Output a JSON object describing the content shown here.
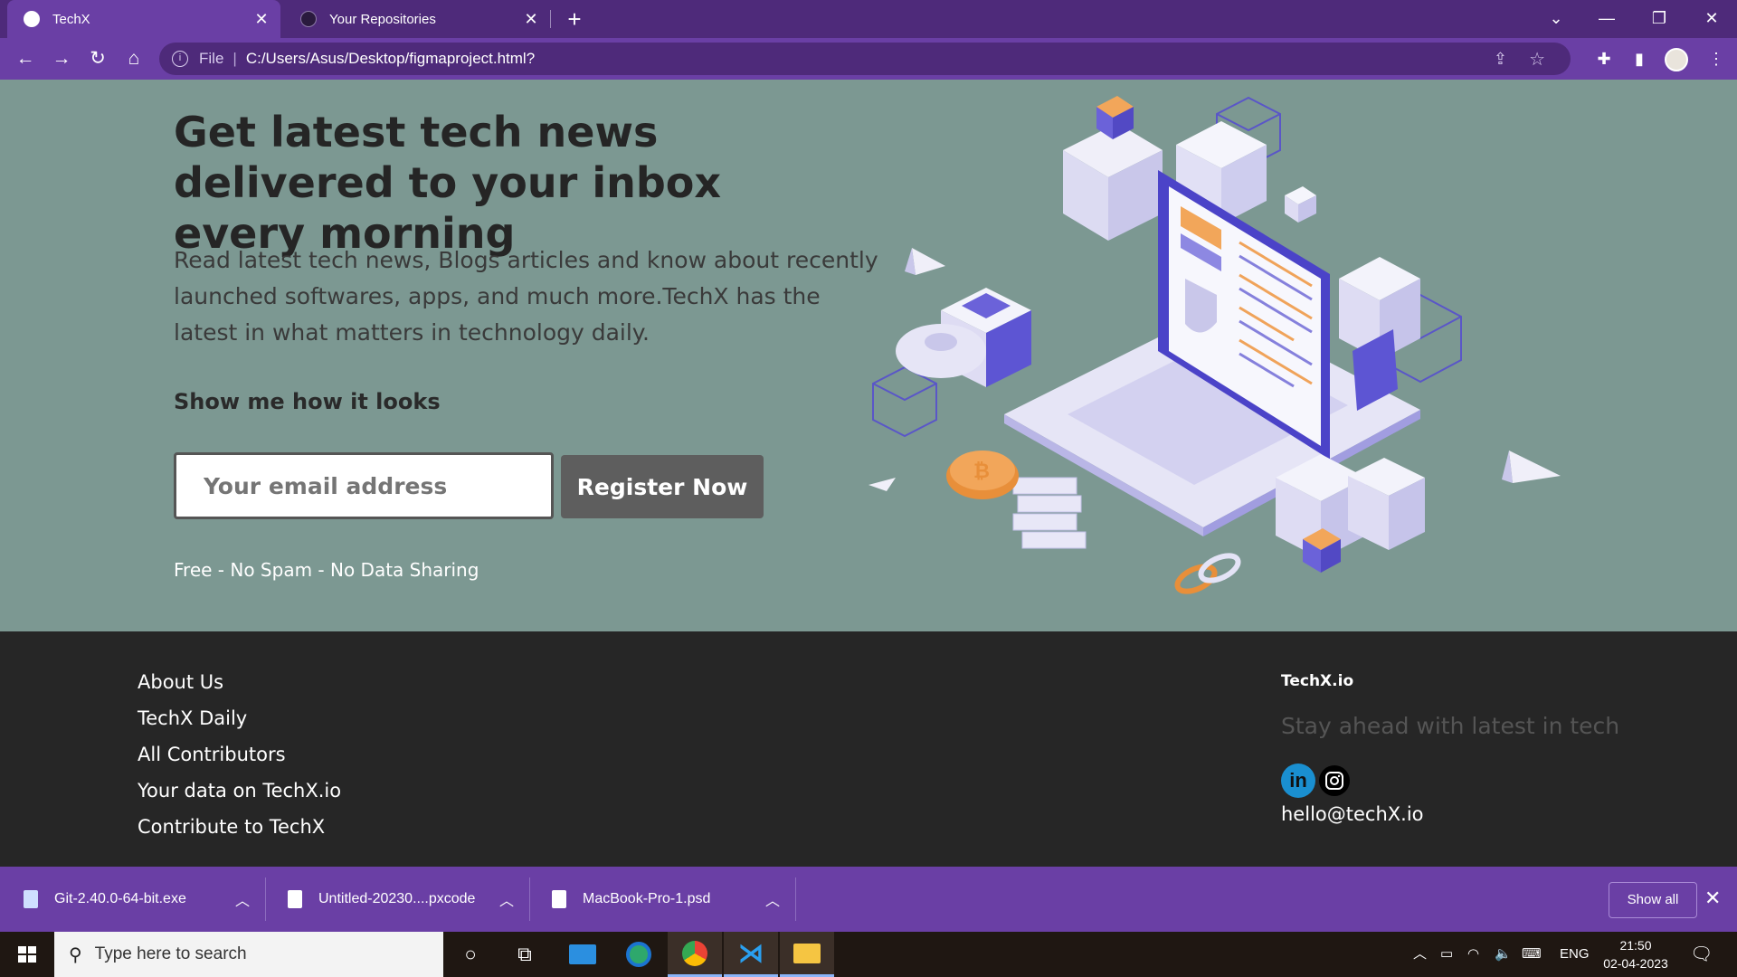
{
  "browser": {
    "tabs": [
      {
        "title": "TechX",
        "active": true
      },
      {
        "title": "Your Repositories",
        "active": false
      }
    ],
    "address": {
      "scheme": "File",
      "url": "C:/Users/Asus/Desktop/figmaproject.html?"
    },
    "colors": {
      "frame": "#4e2a7a",
      "toolbar": "#6a3fa5"
    }
  },
  "hero": {
    "heading": "Get latest tech news delivered to your inbox every morning",
    "lead": "Read latest tech news, Blogs articles and know about recently launched softwares, apps, and much more.TechX has the latest in what matters in technology daily.",
    "subheading": "Show me how it looks",
    "email_placeholder": "Your email address",
    "register_label": "Register Now",
    "fineprint": "Free - No Spam - No Data Sharing",
    "bg_color": "#7c9892"
  },
  "footer": {
    "links": [
      "About Us",
      "TechX Daily",
      "All Contributors",
      "Your data on TechX.io",
      "Contribute to TechX"
    ],
    "brand": "TechX.io",
    "tagline": "Stay ahead with latest in tech",
    "social_icons": [
      "linkedin-icon",
      "instagram-icon"
    ],
    "linkedin_text": "in",
    "email": "hello@techX.io",
    "bg_color": "#262626"
  },
  "downloads": {
    "items": [
      "Git-2.40.0-64-bit.exe",
      "Untitled-20230....pxcode",
      "MacBook-Pro-1.psd"
    ],
    "show_all": "Show all"
  },
  "taskbar": {
    "search_placeholder": "Type here to search",
    "language": "ENG",
    "time": "21:50",
    "date": "02-04-2023"
  }
}
